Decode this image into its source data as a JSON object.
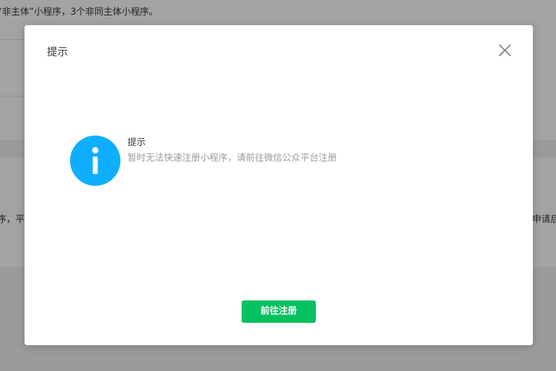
{
  "background": {
    "top_text": "“非主体”小程序，3个非同主体小程序。",
    "left_text": "序，平",
    "right_text": "申请后"
  },
  "dialog": {
    "title": "提示",
    "close_icon": "close-icon",
    "info_icon": "info-icon",
    "info_icon_color": "#10aeff",
    "message_title": "提示",
    "message_desc": "暂时无法快速注册小程序，请前往微信公众平台注册",
    "primary_button_label": "前往注册",
    "primary_button_color": "#07c160"
  }
}
